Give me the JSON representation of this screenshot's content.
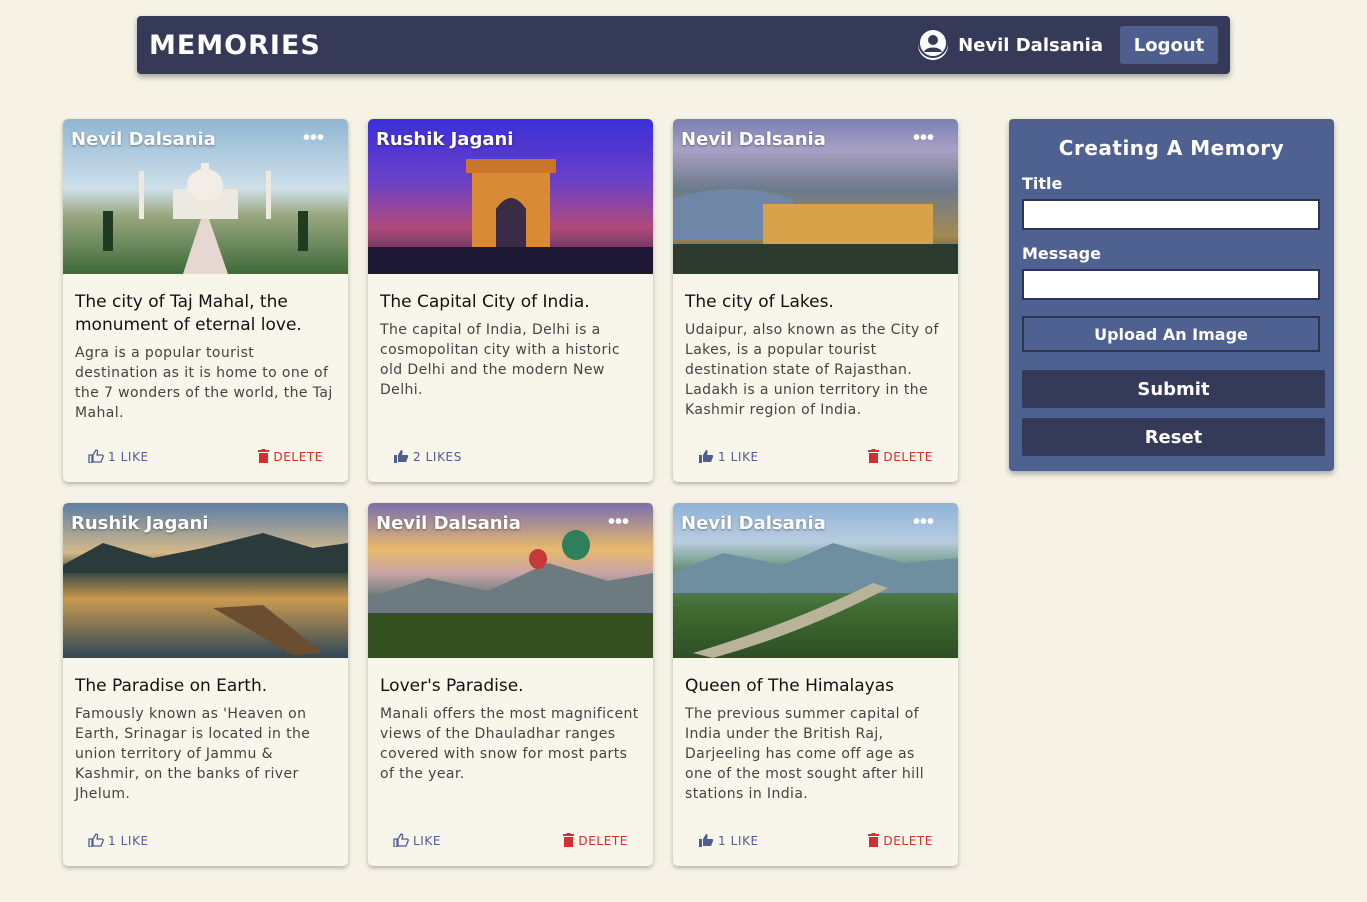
{
  "appbar": {
    "brand": "MEMORIES",
    "user_name": "Nevil Dalsania",
    "logout_label": "Logout"
  },
  "cards": [
    {
      "author": "Nevil Dalsania",
      "menu": "•••",
      "title": "The city of Taj Mahal, the monument of eternal love.",
      "message": "Agra is a popular tourist destination as it is home to one of the 7 wonders of the world, the Taj Mahal.",
      "likes": "1 LIKE",
      "delete": "DELETE"
    },
    {
      "author": "Rushik Jagani",
      "menu": "",
      "title": "The Capital City of India.",
      "message": "The capital of India, Delhi is a cosmopolitan city with a historic old Delhi and the modern New Delhi.",
      "likes": "2 LIKES",
      "delete": ""
    },
    {
      "author": "Nevil Dalsania",
      "menu": "•••",
      "title": "The city of Lakes.",
      "message": "Udaipur, also known as the City of Lakes, is a popular tourist destination state of Rajasthan. Ladakh is a union territory in the Kashmir region of India.",
      "likes": "1 LIKE",
      "delete": "DELETE"
    },
    {
      "author": "Rushik Jagani",
      "menu": "",
      "title": "The Paradise on Earth.",
      "message": "Famously known as 'Heaven on Earth, Srinagar is located in the union territory of Jammu & Kashmir, on the banks of river Jhelum.",
      "likes": "1 LIKE",
      "delete": ""
    },
    {
      "author": "Nevil Dalsania",
      "menu": "•••",
      "title": "Lover's Paradise.",
      "message": "Manali offers the most magnificent views of the Dhauladhar ranges covered with snow for most parts of the year.",
      "likes": "LIKE",
      "delete": "DELETE"
    },
    {
      "author": "Nevil Dalsania",
      "menu": "•••",
      "title": "Queen of The Himalayas",
      "message": "The previous summer capital of India under the British Raj, Darjeeling has come off age as one of the most sought after hill stations in India.",
      "likes": "1 LIKE",
      "delete": "DELETE"
    }
  ],
  "form": {
    "title": "Creating A Memory",
    "title_label": "Title",
    "title_value": "",
    "message_label": "Message",
    "message_value": "",
    "upload_label": "Upload An Image",
    "submit_label": "Submit",
    "reset_label": "Reset"
  },
  "colors": {
    "appbar": "#343a58",
    "panel": "#4f6190",
    "accent": "#4e5e8f",
    "delete": "#d32f2f",
    "background": "#f6f3e6"
  }
}
